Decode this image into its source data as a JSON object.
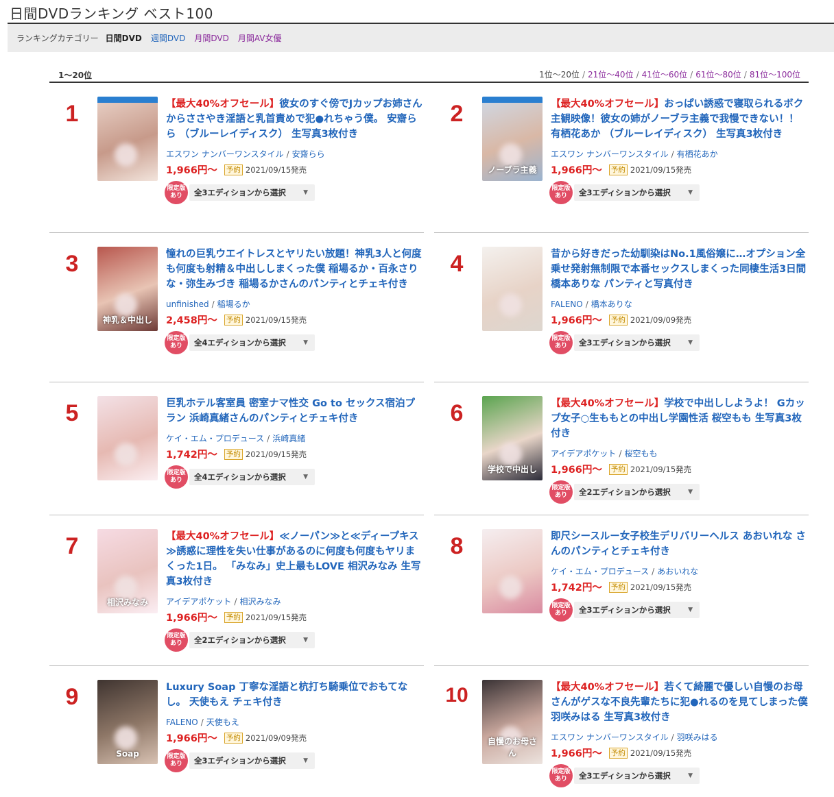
{
  "page": {
    "title": "日間DVDランキング ベスト100"
  },
  "category_bar": {
    "label": "ランキングカテゴリー",
    "current": "日間DVD",
    "links": [
      "週間DVD",
      "月間DVD",
      "月間AV女優"
    ]
  },
  "range": {
    "current": "1〜20位",
    "nav_current": "1位〜20位",
    "nav_links": [
      "21位〜40位",
      "41位〜60位",
      "61位〜80位",
      "81位〜100位"
    ],
    "separator": "/"
  },
  "common": {
    "reserve_badge": "予約",
    "limited_badge_line1": "限定版",
    "limited_badge_line2": "あり",
    "caret": "▼",
    "slash": "/"
  },
  "items": [
    {
      "rank": "1",
      "sale": "【最大40%オフセール】",
      "title": "彼女のすぐ傍でJカップお姉さんからささやき淫語と乳首責めで犯●れちゃう僕。 安齋らら （ブルーレイディスク） 生写真3枚付き",
      "label": "エスワン ナンバーワンスタイル",
      "actress": "安齋らら",
      "price": "1,966円〜",
      "release": "2021/09/15発売",
      "edition": "全3エディションから選択",
      "cover_text": "",
      "colors": [
        "#e9d2c8",
        "#c79a8a",
        "#f2e4dc"
      ]
    },
    {
      "rank": "2",
      "sale": "【最大40%オフセール】",
      "title": "おっぱい誘惑で寝取られるボク主観映像！彼女の姉がノーブラ主義で我慢できない！！ 有栖花あか （ブルーレイディスク） 生写真3枚付き",
      "label": "エスワン ナンバーワンスタイル",
      "actress": "有栖花あか",
      "price": "1,966円〜",
      "release": "2021/09/15発売",
      "edition": "全3エディションから選択",
      "cover_text": "ノーブラ主義",
      "colors": [
        "#cfd9e6",
        "#d9b8a6",
        "#9ab3cf"
      ]
    },
    {
      "rank": "3",
      "sale": "",
      "title": "憧れの巨乳ウエイトレスとヤリたい放題！神乳3人と何度も何度も射精＆中出ししまくった僕 稲場るか・百永さりな・弥生みづき 稲場るかさんのパンティとチェキ付き",
      "label": "unfinished",
      "actress": "稲場るか",
      "price": "2,458円〜",
      "release": "2021/09/15発売",
      "edition": "全4エディションから選択",
      "cover_text": "神乳＆中出し",
      "colors": [
        "#b8574e",
        "#e8c4b4",
        "#6d3a36"
      ]
    },
    {
      "rank": "4",
      "sale": "",
      "title": "昔から好きだった幼馴染はNo.1風俗嬢に…オプション全乗せ発射無制限で本番セックスしまくった同棲生活3日間 橋本ありな パンティと写真付き",
      "label": "FALENO",
      "actress": "橋本ありな",
      "price": "1,966円〜",
      "release": "2021/09/09発売",
      "edition": "全3エディションから選択",
      "cover_text": "",
      "colors": [
        "#f4f1ee",
        "#e7d3c7",
        "#ddd6cf"
      ]
    },
    {
      "rank": "5",
      "sale": "",
      "title": "巨乳ホテル客室員 密室ナマ性交 Go to セックス宿泊プラン 浜崎真緒さんのパンティとチェキ付き",
      "label": "ケイ・エム・プロデュース",
      "actress": "浜崎真緒",
      "price": "1,742円〜",
      "release": "2021/09/15発売",
      "edition": "全4エディションから選択",
      "cover_text": "",
      "colors": [
        "#f3e1e6",
        "#e6b9b2",
        "#fbeff2"
      ]
    },
    {
      "rank": "6",
      "sale": "【最大40%オフセール】",
      "title": "学校で中出ししようよ！ Gカップ女子○生ももとの中出し学園性活 桜空もも 生写真3枚付き",
      "label": "アイデアポケット",
      "actress": "桜空もも",
      "price": "1,966円〜",
      "release": "2021/09/15発売",
      "edition": "全2エディションから選択",
      "cover_text": "学校で中出し",
      "colors": [
        "#5aa44f",
        "#e9d6c9",
        "#2b2b38"
      ]
    },
    {
      "rank": "7",
      "sale": "【最大40%オフセール】",
      "title": "≪ノーパン≫と≪ディープキス≫誘惑に理性を失い仕事があるのに何度も何度もヤリまくった1日。 「みなみ」史上最もLOVE 相沢みなみ 生写真3枚付き",
      "label": "アイデアポケット",
      "actress": "相沢みなみ",
      "price": "1,966円〜",
      "release": "2021/09/15発売",
      "edition": "全2エディションから選択",
      "cover_text": "相沢みなみ",
      "colors": [
        "#f6dbe3",
        "#e9c3bf",
        "#fbeef3"
      ]
    },
    {
      "rank": "8",
      "sale": "",
      "title": "即尺シースルー女子校生デリバリーヘルス あおいれな さんのパンティとチェキ付き",
      "label": "ケイ・エム・プロデュース",
      "actress": "あおいれな",
      "price": "1,742円〜",
      "release": "2021/09/15発売",
      "edition": "全3エディションから選択",
      "cover_text": "",
      "colors": [
        "#f5eef0",
        "#ecc9c4",
        "#d98aa0"
      ]
    },
    {
      "rank": "9",
      "sale": "",
      "title": "Luxury Soap 丁寧な淫語と杭打ち騎乗位でおもてなし。 天使もえ チェキ付き",
      "label": "FALENO",
      "actress": "天使もえ",
      "price": "1,966円〜",
      "release": "2021/09/09発売",
      "edition": "全3エディションから選択",
      "cover_text": "Soap",
      "colors": [
        "#3f3430",
        "#8e7767",
        "#d8c2b3"
      ]
    },
    {
      "rank": "10",
      "sale": "【最大40%オフセール】",
      "title": "若くて綺麗で優しい自慢のお母さんがゲスな不良先輩たちに犯●れるのを見てしまった僕 羽咲みはる 生写真3枚付き",
      "label": "エスワン ナンバーワンスタイル",
      "actress": "羽咲みはる",
      "price": "1,966円〜",
      "release": "2021/09/15発売",
      "edition": "全3エディションから選択",
      "cover_text": "自慢のお母さん",
      "colors": [
        "#3a3335",
        "#c9a79d",
        "#ece3de"
      ]
    }
  ]
}
